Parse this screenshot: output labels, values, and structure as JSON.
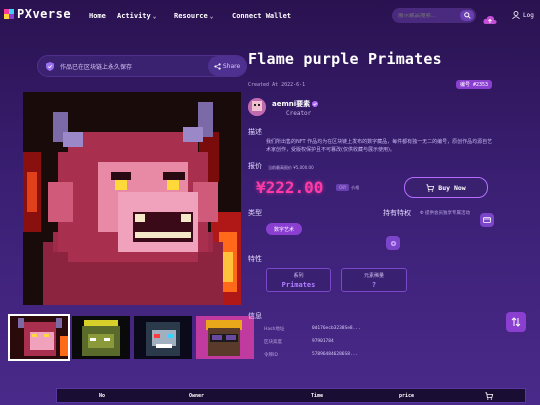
{
  "colors": {
    "accent": "#8a3fd0",
    "price": "#ff3aa7",
    "bg": "#3a1f73"
  },
  "header": {
    "logo_text": "PXverse",
    "nav": [
      "Home",
      "Activity",
      "Resource",
      "Connect Wallet"
    ],
    "search_placeholder": "展示藏品搜索...",
    "user_label": "Log"
  },
  "left": {
    "collect_text": "作品已在区块链上永久保存",
    "share_label": "Share"
  },
  "detail": {
    "title": "Flame purple Primates",
    "created": "Created At 2022-6-1",
    "id_badge": "编号 #2353",
    "creator_name": "aemni要素",
    "creator_role": "Creator",
    "desc_label": "描述",
    "description": "我们所出售的NFT 作品均为在区块链上发布的数字藏品，每件都有独一无二的编号，原创作品均源自艺术家创作，受版权保护且不可篡改(仅供收藏与展示使用)。",
    "price_label": "报价",
    "price_note": "当前最高报价 ¥5,000.00",
    "price": "¥222.00",
    "price_chip": "CNY",
    "price_suffix": "价格",
    "buy_label": "Buy Now",
    "type_label": "类型",
    "type_value": "数字艺术",
    "perk_label": "持有特权",
    "perk_note": "Φ 提供会员独享专属活动",
    "attr_label": "特性",
    "attrs": [
      {
        "key": "系列",
        "value": "Primates"
      },
      {
        "key": "元素稀量",
        "value": "?"
      }
    ],
    "info_label": "信息",
    "info": [
      {
        "key": "Hash地址",
        "value": "0d176ecb3238Se8..."
      },
      {
        "key": "区块高度",
        "value": "97901784"
      },
      {
        "key": "令牌ID",
        "value": "578964846286S8..."
      }
    ]
  },
  "table": {
    "columns": [
      "No",
      "Owner",
      "Time",
      "price"
    ]
  }
}
